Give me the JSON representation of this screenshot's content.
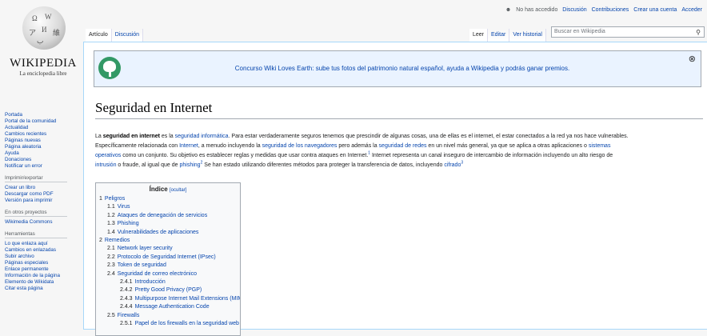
{
  "personal_tools": {
    "not_logged": "No has accedido",
    "links": [
      "Discusión",
      "Contribuciones",
      "Crear una cuenta",
      "Acceder"
    ]
  },
  "logo": {
    "wordmark": "WIKIPEDIA",
    "tagline": "La enciclopedia libre"
  },
  "tabs_left": [
    "Artículo",
    "Discusión"
  ],
  "tabs_right": [
    "Leer",
    "Editar",
    "Ver historial"
  ],
  "search": {
    "placeholder": "Buscar en Wikipedia"
  },
  "banner": {
    "text": "Concurso Wiki Loves Earth: sube tus fotos del patrimonio natural español, ayuda a Wikipedia y podrás ganar premios."
  },
  "page_title": "Seguridad en Internet",
  "intro": {
    "p1_bold": "seguridad en internet",
    "p1_a": "La ",
    "p1_b": " es la ",
    "link_seginf": "seguridad informática",
    "p1_c": ". Para estar verdaderamente seguros tenemos que prescindir de algunas cosas, una de ellas es el internet, el estar conectados a la red ya nos hace vulnerables.",
    "p2_a": "Específicamente relacionada con ",
    "link_internet": "Internet",
    "p2_b": ", a menudo incluyendo la ",
    "link_nav": "seguridad de los navegadores",
    "p2_c": " pero además la ",
    "link_redes": "seguridad de redes",
    "p2_d": " en un nivel más general, ya que se aplica a otras aplicaciones o ",
    "link_so1": "sistemas",
    "link_so2": "operativos",
    "p2_e": " como un conjunto. Su objetivo es establecer reglas y medidas que usar contra ataques en Internet.",
    "ref1": "1",
    "p2_f": " Internet representa un canal inseguro de intercambio de información incluyendo un alto riesgo de",
    "link_intrusion": "intrusión",
    "p2_g": " o fraude, al igual que de ",
    "link_phishing": "phishing",
    "ref2": "2",
    "p2_h": " Se han estado utilizando diferentes métodos para proteger la transferencia de datos, incluyendo ",
    "link_cifrado": "cifrado",
    "ref3": "3"
  },
  "toc": {
    "title": "Índice",
    "hide": "[ocultar]",
    "items": [
      {
        "num": "1",
        "label": "Peligros",
        "level": 1
      },
      {
        "num": "1.1",
        "label": "Virus",
        "level": 2
      },
      {
        "num": "1.2",
        "label": "Ataques de denegación de servicios",
        "level": 2
      },
      {
        "num": "1.3",
        "label": "Phishing",
        "level": 2
      },
      {
        "num": "1.4",
        "label": "Vulnerabilidades de aplicaciones",
        "level": 2
      },
      {
        "num": "2",
        "label": "Remedios",
        "level": 1
      },
      {
        "num": "2.1",
        "label": "Network layer security",
        "level": 2
      },
      {
        "num": "2.2",
        "label": "Protocolo de Seguridad Internet (IPsec)",
        "level": 2
      },
      {
        "num": "2.3",
        "label": "Token de seguridad",
        "level": 2
      },
      {
        "num": "2.4",
        "label": "Seguridad de correo electrónico",
        "level": 2
      },
      {
        "num": "2.4.1",
        "label": "Introducción",
        "level": 3
      },
      {
        "num": "2.4.2",
        "label": "Pretty Good Privacy (PGP)",
        "level": 3
      },
      {
        "num": "2.4.3",
        "label": "Multipurpose Internet Mail Extensions (MIME)",
        "level": 3
      },
      {
        "num": "2.4.4",
        "label": "Message Authentication Code",
        "level": 3
      },
      {
        "num": "2.5",
        "label": "Firewalls",
        "level": 2
      },
      {
        "num": "2.5.1",
        "label": "Papel de los firewalls en la seguridad web",
        "level": 3
      }
    ]
  },
  "sidebar": {
    "nav": [
      "Portada",
      "Portal de la comunidad",
      "Actualidad",
      "Cambios recientes",
      "Páginas nuevas",
      "Página aleatoria",
      "Ayuda",
      "Donaciones",
      "Notificar un error"
    ],
    "print_head": "Imprimir/exportar",
    "print": [
      "Crear un libro",
      "Descargar como PDF",
      "Versión para imprimir"
    ],
    "projects_head": "En otros proyectos",
    "projects": [
      "Wikimedia Commons"
    ],
    "tools_head": "Herramientas",
    "tools": [
      "Lo que enlaza aquí",
      "Cambios en enlazadas",
      "Subir archivo",
      "Páginas especiales",
      "Enlace permanente",
      "Información de la página",
      "Elemento de Wikidata",
      "Citar esta página"
    ]
  }
}
